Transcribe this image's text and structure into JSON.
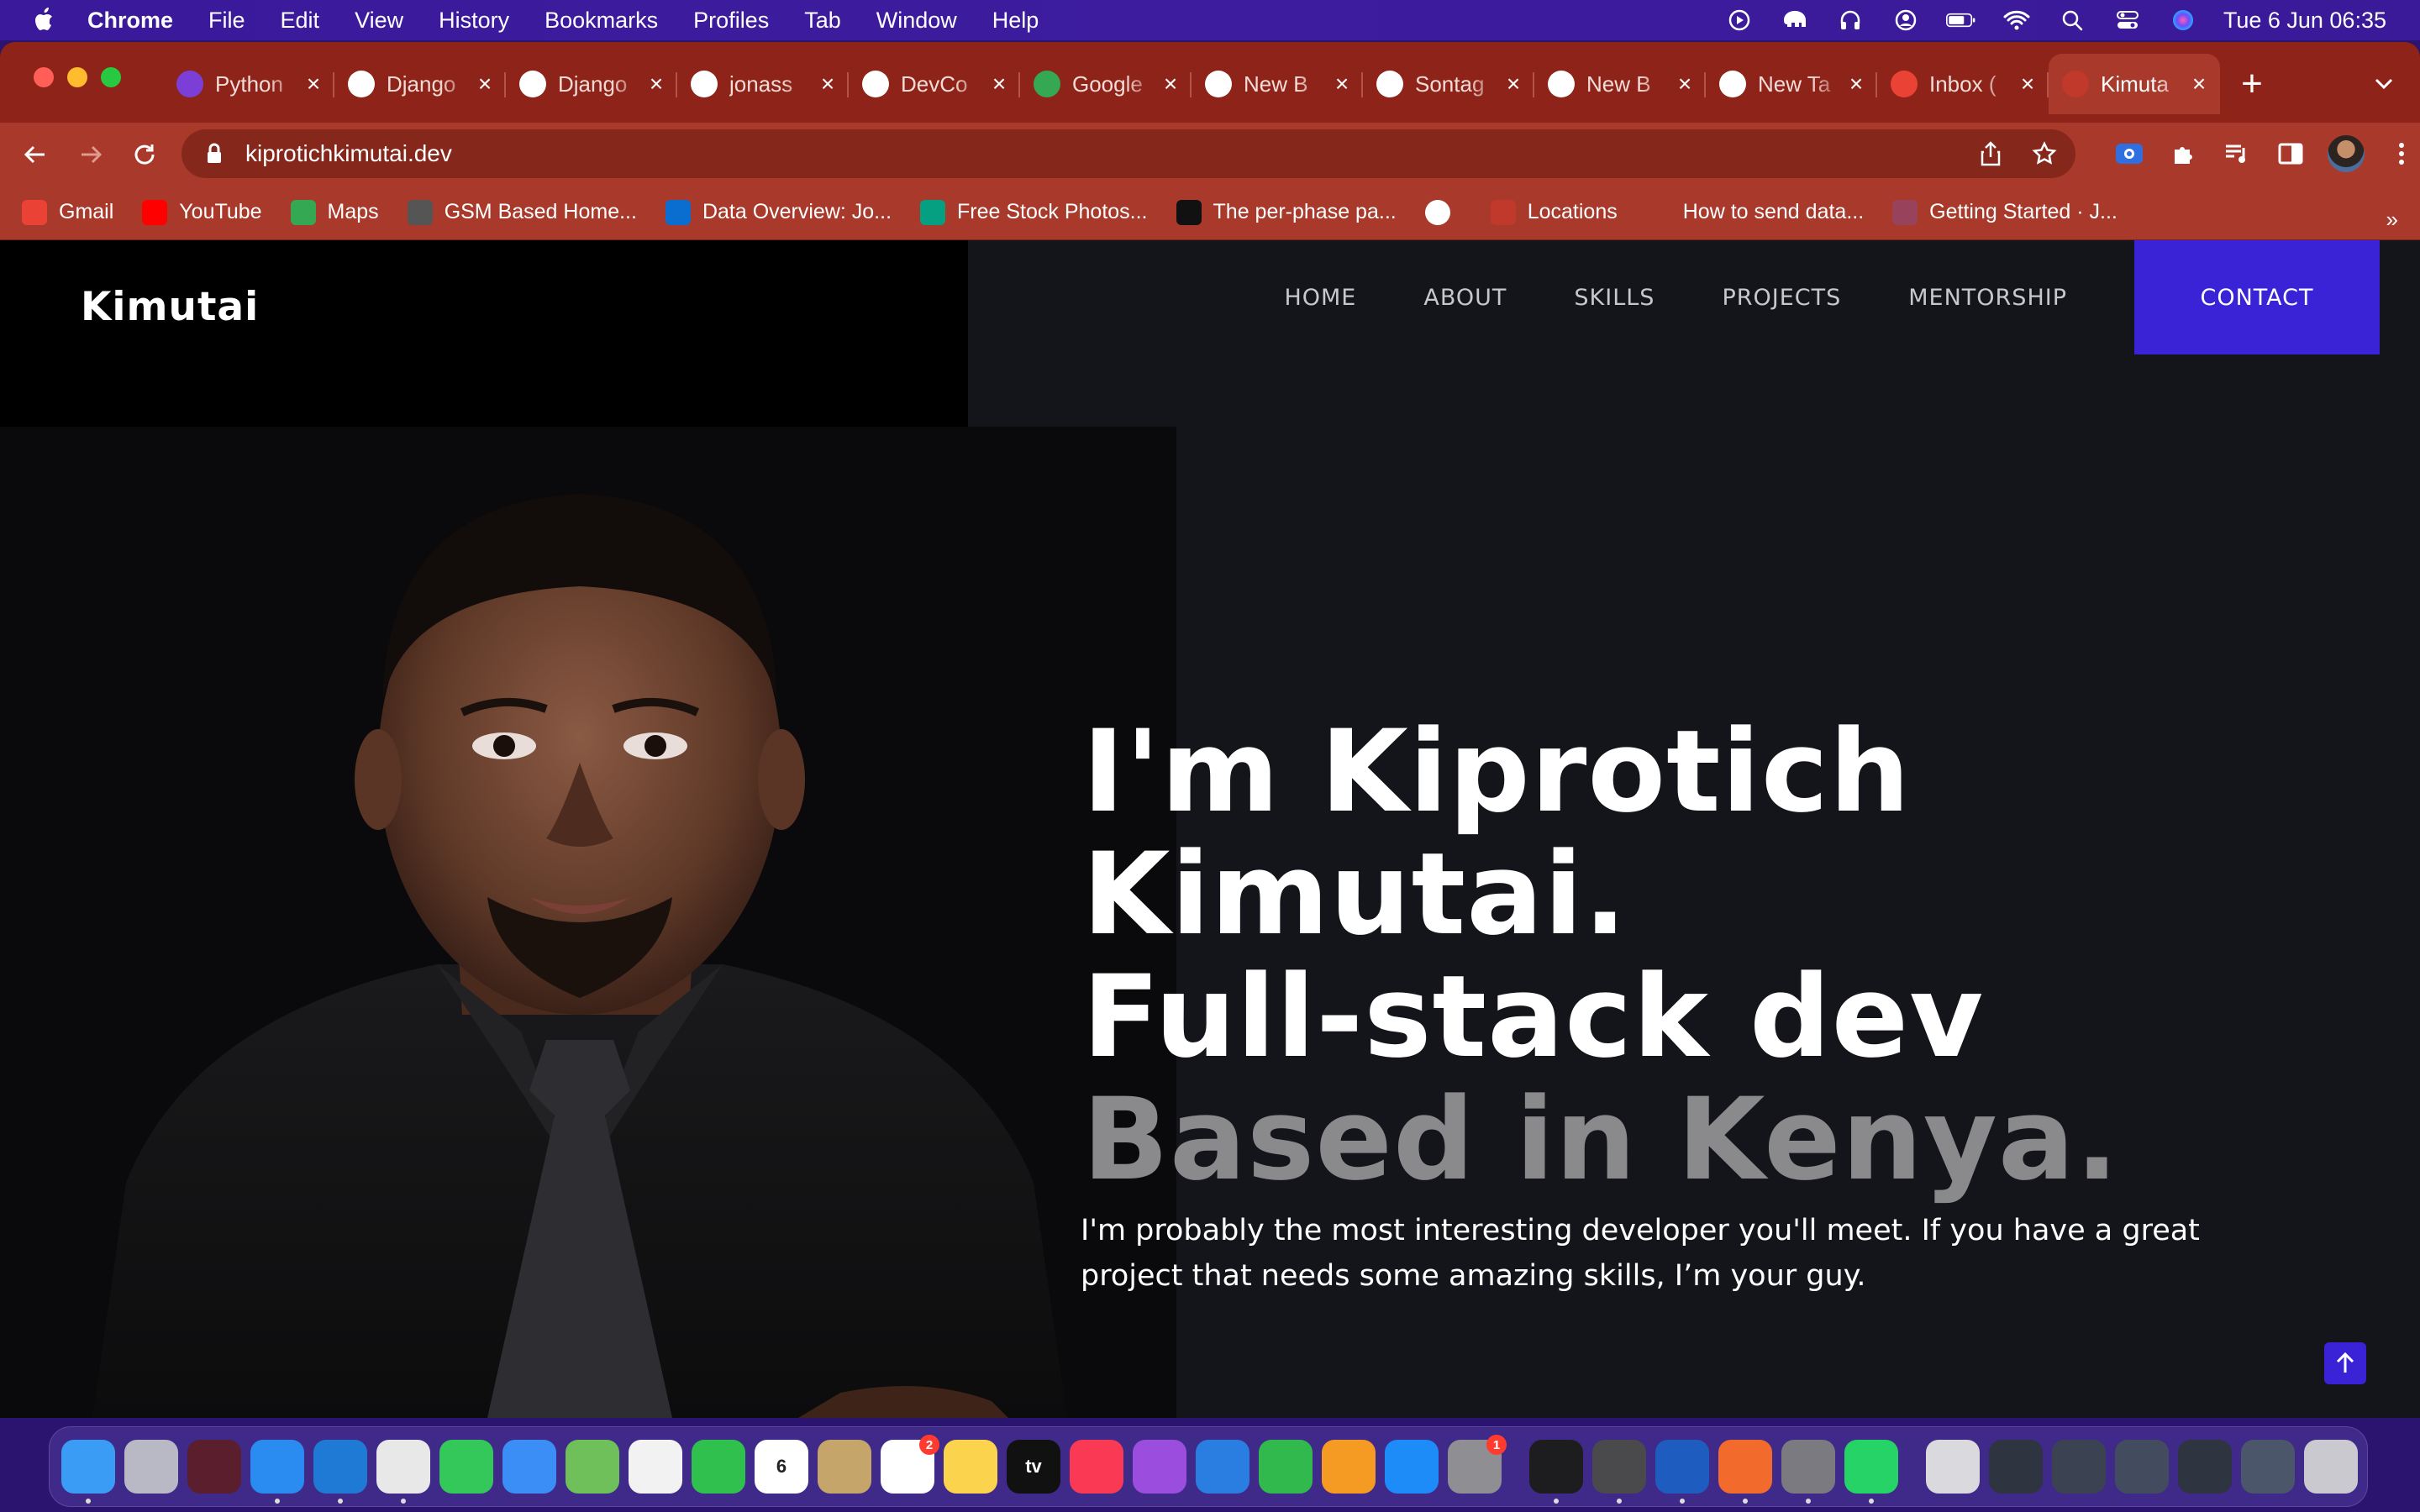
{
  "menubar": {
    "app_name": "Chrome",
    "items": [
      "File",
      "Edit",
      "View",
      "History",
      "Bookmarks",
      "Profiles",
      "Tab",
      "Window",
      "Help"
    ],
    "clock": "Tue 6 Jun  06:35"
  },
  "tabs": [
    {
      "title": "Python",
      "icon": "python-icon",
      "color": "#7b3fd8"
    },
    {
      "title": "Django",
      "icon": "github-icon",
      "color": "#ffffff"
    },
    {
      "title": "Django",
      "icon": "github-icon",
      "color": "#ffffff"
    },
    {
      "title": "jonass",
      "icon": "github-icon",
      "color": "#ffffff"
    },
    {
      "title": "DevCo",
      "icon": "globe-icon",
      "color": "#ffffff"
    },
    {
      "title": "Google",
      "icon": "google-meet-icon",
      "color": "#34a853"
    },
    {
      "title": "New B",
      "icon": "kit-icon",
      "color": "#ffffff"
    },
    {
      "title": "Sontag",
      "icon": "github-icon",
      "color": "#ffffff"
    },
    {
      "title": "New B",
      "icon": "kit-icon",
      "color": "#ffffff"
    },
    {
      "title": "New Ta",
      "icon": "chrome-icon",
      "color": "#ffffff"
    },
    {
      "title": "Inbox (",
      "icon": "gmail-icon",
      "color": "#ea4335"
    },
    {
      "title": "Kimuta",
      "icon": "site-favicon",
      "color": "#c0392b",
      "active": true
    }
  ],
  "address_bar": {
    "url": "kiprotichkimutai.dev"
  },
  "bookmarks": [
    {
      "label": "Gmail",
      "icon": "gmail-icon",
      "color": "#ea4335"
    },
    {
      "label": "YouTube",
      "icon": "youtube-icon",
      "color": "#ff0000"
    },
    {
      "label": "Maps",
      "icon": "maps-icon",
      "color": "#34a853"
    },
    {
      "label": "GSM Based Home...",
      "icon": "shield-icon",
      "color": "#555555"
    },
    {
      "label": "Data Overview: Jo...",
      "icon": "sap-icon",
      "color": "#0a6ed1"
    },
    {
      "label": "Free Stock Photos...",
      "icon": "pexels-icon",
      "color": "#05a081"
    },
    {
      "label": "The per-phase pa...",
      "icon": "infinity-icon",
      "color": "#111111"
    },
    {
      "label": "",
      "icon": "globe-icon",
      "color": "#ffffff"
    },
    {
      "label": "Locations",
      "icon": "heart-icon",
      "color": "#c0392b"
    },
    {
      "label": "How to send data...",
      "icon": "person-icon",
      "color": "#a8392b"
    },
    {
      "label": "Getting Started · J...",
      "icon": "jest-icon",
      "color": "#99425b"
    }
  ],
  "site": {
    "logo": "Kimutai",
    "nav": [
      "HOME",
      "ABOUT",
      "SKILLS",
      "PROJECTS",
      "MENTORSHIP"
    ],
    "contact": "CONTACT",
    "hero": {
      "line1": "I'm Kiprotich",
      "line2": "Kimutai.",
      "line3": "Full-stack dev",
      "line4": "Based in Kenya.",
      "description": "I'm probably the most interesting developer you'll meet. If you have a great project that needs some amazing skills, I’m your guy."
    },
    "accent": "#3a22d6"
  },
  "dock": {
    "apps": [
      {
        "name": "finder-icon",
        "color": "#3b9cf5",
        "running": true
      },
      {
        "name": "launchpad-icon",
        "color": "#b9b9c6"
      },
      {
        "name": "unknown-app-icon",
        "color": "#5a1e2c"
      },
      {
        "name": "safari-icon",
        "color": "#2a8cf0",
        "running": true
      },
      {
        "name": "vscode-icon",
        "color": "#1f7ad6",
        "running": true
      },
      {
        "name": "chrome-icon",
        "color": "#e8e8e8",
        "running": true
      },
      {
        "name": "messages-icon",
        "color": "#34c759"
      },
      {
        "name": "mail-icon",
        "color": "#3a8ef6"
      },
      {
        "name": "maps-icon",
        "color": "#6fbf5b"
      },
      {
        "name": "photos-icon",
        "color": "#f2f2f2"
      },
      {
        "name": "facetime-icon",
        "color": "#30c04e"
      },
      {
        "name": "calendar-icon",
        "color": "#ffffff",
        "label": "6"
      },
      {
        "name": "contacts-icon",
        "color": "#c5a56a"
      },
      {
        "name": "reminders-icon",
        "color": "#ffffff",
        "badge": "2"
      },
      {
        "name": "notes-icon",
        "color": "#fbd34d"
      },
      {
        "name": "apple-tv-icon",
        "color": "#111111",
        "label": "tv"
      },
      {
        "name": "music-icon",
        "color": "#fa3a55"
      },
      {
        "name": "podcasts-icon",
        "color": "#9b4dde"
      },
      {
        "name": "keynote-icon",
        "color": "#2a7de1"
      },
      {
        "name": "numbers-icon",
        "color": "#31b94d"
      },
      {
        "name": "pages-icon",
        "color": "#f59a23"
      },
      {
        "name": "app-store-icon",
        "color": "#1d8cf8"
      },
      {
        "name": "system-settings-icon",
        "color": "#8e8e93",
        "badge": "1"
      },
      {
        "separator": true
      },
      {
        "name": "terminal-icon",
        "color": "#1d1d1f",
        "running": true
      },
      {
        "name": "calculator-icon",
        "color": "#4a4a4c",
        "running": true
      },
      {
        "name": "word-icon",
        "color": "#1f5cbf",
        "running": true
      },
      {
        "name": "sketch-pen-icon",
        "color": "#f36b2c",
        "running": true
      },
      {
        "name": "rocket-icon",
        "color": "#7a7a80",
        "running": true
      },
      {
        "name": "whatsapp-icon",
        "color": "#25d366",
        "running": true
      },
      {
        "separator": true
      },
      {
        "name": "documents-folder-icon",
        "color": "#d9d9de"
      },
      {
        "name": "window-thumb-icon",
        "color": "#2e3440"
      },
      {
        "name": "window-thumb-icon",
        "color": "#3b4252"
      },
      {
        "name": "window-thumb-icon",
        "color": "#434c5e"
      },
      {
        "name": "window-thumb-icon",
        "color": "#2e3440"
      },
      {
        "name": "window-thumb-icon",
        "color": "#4c566a"
      },
      {
        "name": "trash-icon",
        "color": "#c9c9cf"
      }
    ]
  }
}
